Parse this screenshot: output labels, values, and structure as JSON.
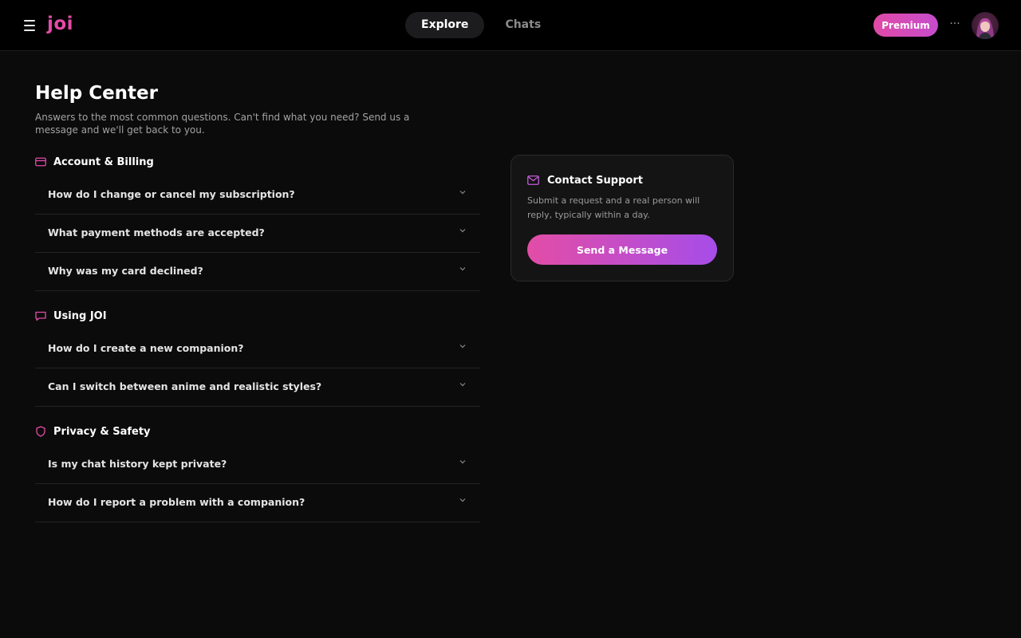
{
  "header": {
    "logo": "joi",
    "tabs": [
      {
        "label": "Explore",
        "active": true
      },
      {
        "label": "Chats",
        "active": false
      }
    ],
    "premium_label": "Premium",
    "more_label": "···"
  },
  "page": {
    "title": "Help Center",
    "subtitle": "Answers to the most common questions. Can't find what you need? Send us a message and we'll get back to you."
  },
  "sections": [
    {
      "title": "Account & Billing",
      "icon": "credit-card-icon",
      "questions": [
        "How do I change or cancel my subscription?",
        "What payment methods are accepted?",
        "Why was my card declined?"
      ]
    },
    {
      "title": "Using JOI",
      "icon": "chat-bubble-icon",
      "questions": [
        "How do I create a new companion?",
        "Can I switch between anime and realistic styles?"
      ]
    },
    {
      "title": "Privacy & Safety",
      "icon": "shield-icon",
      "questions": [
        "Is my chat history kept private?",
        "How do I report a problem with a companion?"
      ]
    }
  ],
  "contact": {
    "title": "Contact Support",
    "icon": "mail-icon",
    "text": "Submit a request and a real person will reply, typically within a day.",
    "button_label": "Send a Message"
  },
  "colors": {
    "accent_pink": "#e44ba8",
    "accent_purple": "#a64de8",
    "background": "#0b0b0b"
  }
}
